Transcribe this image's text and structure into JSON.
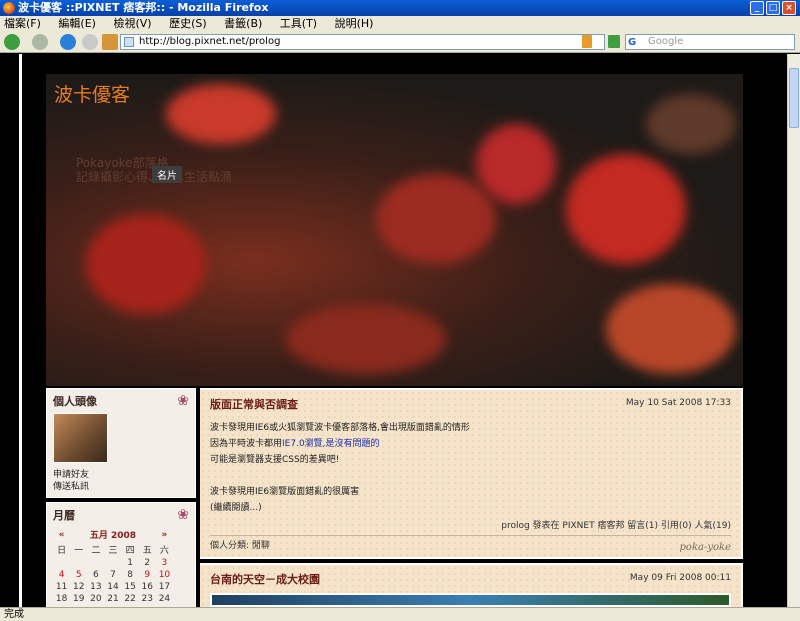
{
  "window": {
    "title": "波卡優客 ::PIXNET 痞客邦:: - Mozilla Firefox"
  },
  "menu": [
    "檔案(F)",
    "編輯(E)",
    "檢視(V)",
    "歷史(S)",
    "書籤(B)",
    "工具(T)",
    "說明(H)"
  ],
  "nav": {
    "url": "http://blog.pixnet.net/prolog",
    "search_placeholder": "Google"
  },
  "blog": {
    "title": "波卡優客",
    "desc_line1": "Pokayoke部落格",
    "desc_line2": "記錄攝影心得、分享生活點滴",
    "name_tag": "名片"
  },
  "sidebar": {
    "profile": {
      "title": "個人頭像",
      "links": [
        "申請好友",
        "傳送私訊"
      ]
    },
    "calendar": {
      "title": "月曆",
      "prev": "«",
      "month": "五月 2008",
      "next": "»",
      "weekdays": [
        "日",
        "一",
        "二",
        "三",
        "四",
        "五",
        "六"
      ],
      "weeks": [
        [
          "",
          "",
          "",
          "",
          "1",
          "2",
          "3"
        ],
        [
          "4",
          "5",
          "6",
          "7",
          "8",
          "9",
          "10"
        ],
        [
          "11",
          "12",
          "13",
          "14",
          "15",
          "16",
          "17"
        ],
        [
          "18",
          "19",
          "20",
          "21",
          "22",
          "23",
          "24"
        ]
      ]
    }
  },
  "posts": [
    {
      "title": "版面正常與否調查",
      "date": "May 10 Sat 2008 17:33",
      "lines": [
        "波卡發現用IE6或火狐瀏覽波卡優客部落格,會出現版面錯亂的情形",
        "因為平時波卡都用IE7.0瀏覽,是沒有問題的",
        "可能是瀏覽器支援CSS的差異吧!",
        "",
        "波卡發現用IE6瀏覽版面錯亂的很厲害"
      ],
      "link_text": "IE7.0瀏覽,是沒有問題的",
      "more": "(繼續閱讀...)",
      "meta": "prolog 發表在 PIXNET 痞客邦 留言(1) 引用(0) 人氣(19)",
      "category": "個人分類: 閒聊",
      "signature": "poka-yoke"
    },
    {
      "title": "台南的天空－成大校園",
      "date": "May 09 Fri 2008 00:11"
    }
  ],
  "status": "完成"
}
